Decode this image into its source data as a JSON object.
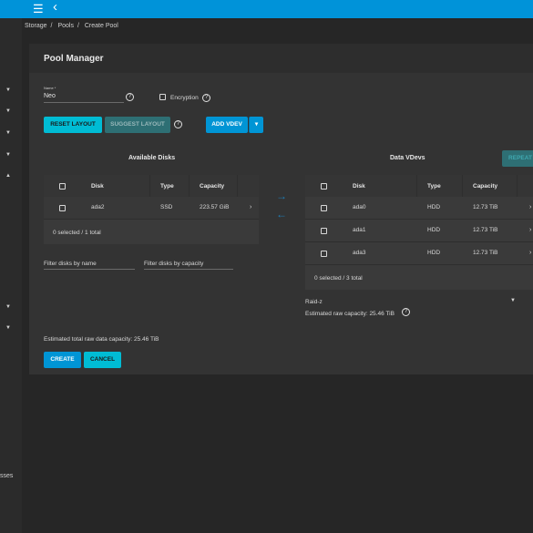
{
  "topbar": {
    "menu_icon": "☰",
    "back_icon": "‹"
  },
  "breadcrumb": [
    "Storage",
    "/",
    "Pools",
    "/",
    "Create Pool"
  ],
  "sidebar": {
    "partial_label": "sses"
  },
  "card": {
    "title": "Pool Manager"
  },
  "name_field": {
    "label": "Name *",
    "value": "Neo"
  },
  "encryption": {
    "label": "Encryption"
  },
  "buttons": {
    "reset_layout": "RESET LAYOUT",
    "suggest_layout": "SUGGEST LAYOUT",
    "add_vdev": "ADD VDEV",
    "repeat": "REPEAT",
    "create": "CREATE",
    "cancel": "CANCEL"
  },
  "available_disks": {
    "title": "Available Disks",
    "headers": [
      "Disk",
      "Type",
      "Capacity"
    ],
    "rows": [
      {
        "disk": "ada2",
        "type": "SSD",
        "capacity": "223.57 GiB"
      }
    ],
    "footer": "0 selected / 1 total"
  },
  "filters": {
    "by_name": "Filter disks by name",
    "by_capacity": "Filter disks by capacity"
  },
  "data_vdevs": {
    "title": "Data VDevs",
    "headers": [
      "Disk",
      "Type",
      "Capacity"
    ],
    "rows": [
      {
        "disk": "ada0",
        "type": "HDD",
        "capacity": "12.73 TiB"
      },
      {
        "disk": "ada1",
        "type": "HDD",
        "capacity": "12.73 TiB"
      },
      {
        "disk": "ada3",
        "type": "HDD",
        "capacity": "12.73 TiB"
      }
    ],
    "footer": "0 selected / 3 total",
    "layout_value": "Raid-z",
    "raw_capacity": "Estimated raw capacity: 25.46 TiB"
  },
  "estimated_total": "Estimated total raw data capacity: 25.46 TiB",
  "colors": {
    "accent": "#0095d5",
    "cyan": "#00bcd4",
    "topbar": "#0093d9"
  }
}
